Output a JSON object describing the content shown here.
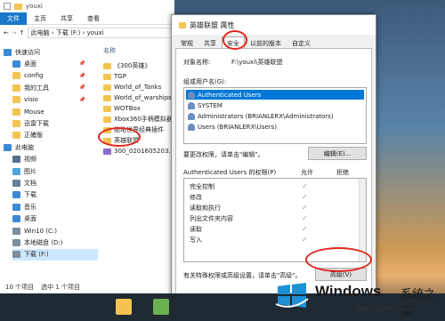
{
  "explorer": {
    "title": "youxi",
    "ribbon_tabs": [
      "文件",
      "主页",
      "共享",
      "查看"
    ],
    "address_path": "此电脑 › 下载 (F:) › youxi",
    "nav_items": [
      {
        "label": "快速访问",
        "icon": "star-icon",
        "pinned": false
      },
      {
        "label": "桌面",
        "icon": "desktop-icon",
        "pinned": true
      },
      {
        "label": "config",
        "icon": "folder-icon",
        "pinned": true
      },
      {
        "label": "我的工具",
        "icon": "folder-icon",
        "pinned": true
      },
      {
        "label": "visio",
        "icon": "folder-icon",
        "pinned": true
      },
      {
        "label": "Mouse",
        "icon": "folder-icon",
        "pinned": false
      },
      {
        "label": "迅雷下载",
        "icon": "folder-icon",
        "pinned": false
      },
      {
        "label": "正確版",
        "icon": "folder-icon",
        "pinned": false
      },
      {
        "label": "此电脑",
        "icon": "computer-icon",
        "pinned": false
      },
      {
        "label": "视频",
        "icon": "video-icon",
        "pinned": false
      },
      {
        "label": "图片",
        "icon": "picture-icon",
        "pinned": false
      },
      {
        "label": "文档",
        "icon": "document-icon",
        "pinned": false
      },
      {
        "label": "下载",
        "icon": "download-icon",
        "pinned": false
      },
      {
        "label": "音乐",
        "icon": "music-icon",
        "pinned": false
      },
      {
        "label": "桌面",
        "icon": "desktop-icon",
        "pinned": false
      },
      {
        "label": "Win10 (C:)",
        "icon": "drive-icon",
        "pinned": false
      },
      {
        "label": "本地磁盘 (D:)",
        "icon": "drive-icon",
        "pinned": false
      },
      {
        "label": "下载 (F:)",
        "icon": "drive-icon",
        "pinned": false
      }
    ],
    "column_header": "名称",
    "files": [
      "《300英雄》",
      "TGP",
      "World_of_Tanks",
      "World_of_warships",
      "WOTBox",
      "Xbox360手柄模拟器",
      "绝地世界经典插件",
      "英雄联盟",
      "300_0201605203.zip"
    ],
    "status": [
      "10 个项目",
      "选中 1 个项目"
    ]
  },
  "dialog": {
    "title": "英雄联盟 属性",
    "tabs": [
      "常规",
      "共享",
      "安全",
      "以前的版本",
      "自定义"
    ],
    "active_tab": "安全",
    "object_label": "对象名称:",
    "object_value": "F:\\youxi\\英雄联盟",
    "groups_label": "组或用户名(G):",
    "groups": [
      "Authenticated Users",
      "SYSTEM",
      "Administrators (BRIANLERX\\Administrators)",
      "Users (BRIANLERX\\Users)"
    ],
    "change_hint": "要更改权限，请单击\"编辑\"。",
    "edit_button": "编辑(E)...",
    "perm_label": "Authenticated Users 的权限(P)",
    "allow_header": "允许",
    "deny_header": "拒绝",
    "permissions": [
      {
        "name": "完全控制",
        "allow": true
      },
      {
        "name": "修改",
        "allow": true
      },
      {
        "name": "读取和执行",
        "allow": true
      },
      {
        "name": "列出文件夹内容",
        "allow": true
      },
      {
        "name": "读取",
        "allow": true
      },
      {
        "name": "写入",
        "allow": true
      }
    ],
    "advanced_hint": "有关特殊权限或高级设置，请单击\"高级\"。",
    "advanced_button": "高级(V)",
    "ok_button": "确定"
  },
  "watermark": {
    "title": "Windows",
    "subtitle": "系统之家",
    "url": "www.bjjmlv.com"
  },
  "colors": {
    "accent": "#0078d7",
    "highlight": "#e0261c"
  }
}
